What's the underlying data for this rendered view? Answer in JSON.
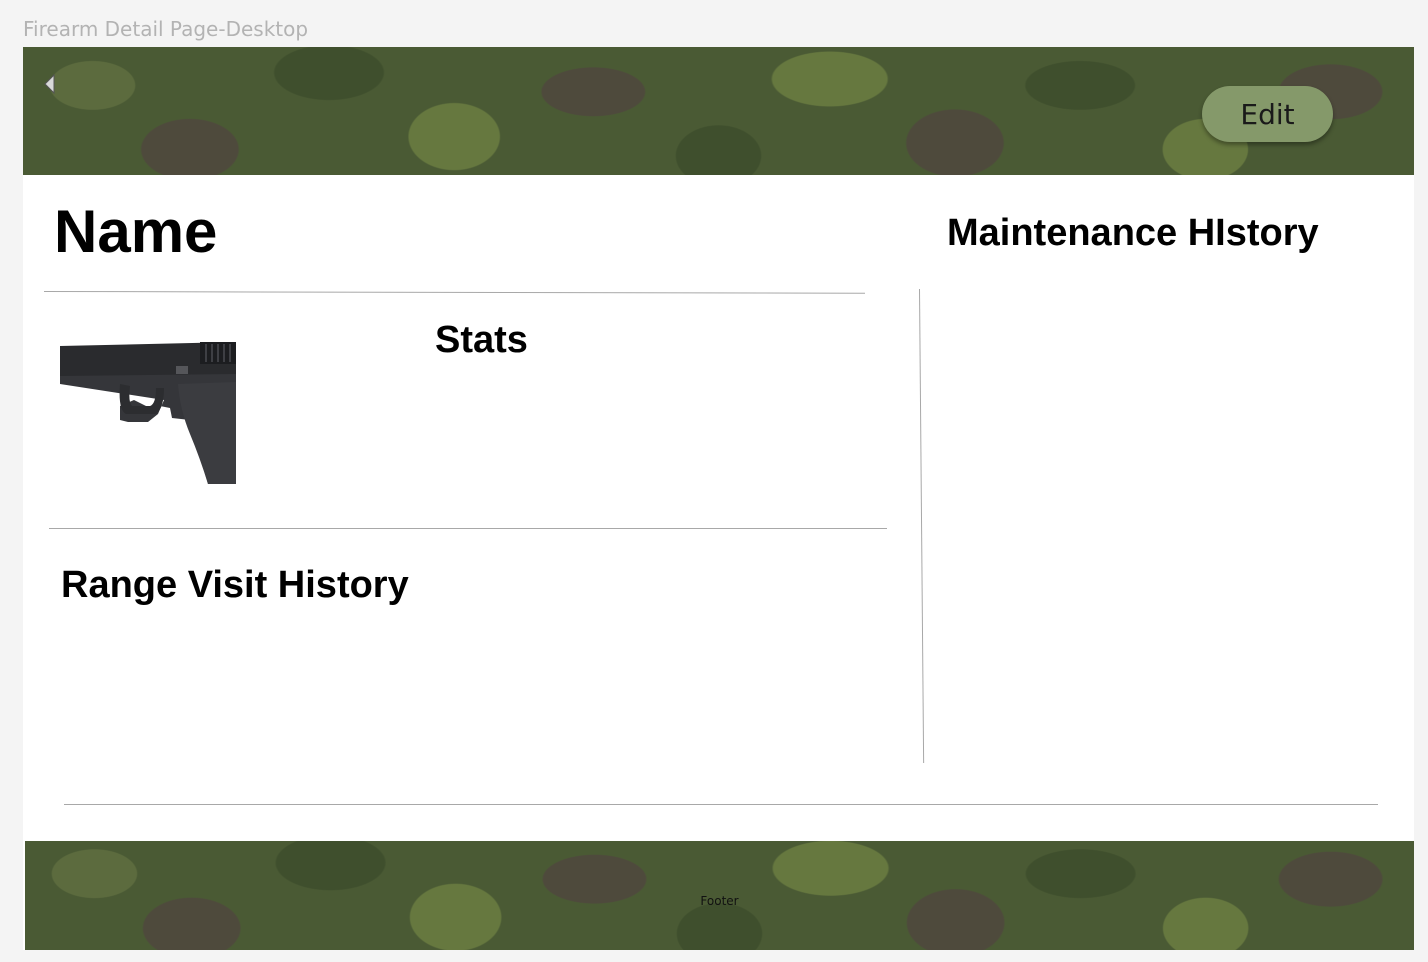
{
  "frame_label": "Firearm Detail Page-Desktop",
  "header": {
    "back_icon": "chevron-left-icon",
    "edit_label": "Edit"
  },
  "main": {
    "name": "Name",
    "stats_heading": "Stats",
    "range_heading": "Range Visit History",
    "maintenance_heading": "Maintenance HIstory",
    "image": "pistol-image"
  },
  "footer": {
    "text": "Footer"
  },
  "colors": {
    "accent_button": "#85996a",
    "camo_base": "#4a5a34",
    "divider": "#a8a8a8"
  }
}
